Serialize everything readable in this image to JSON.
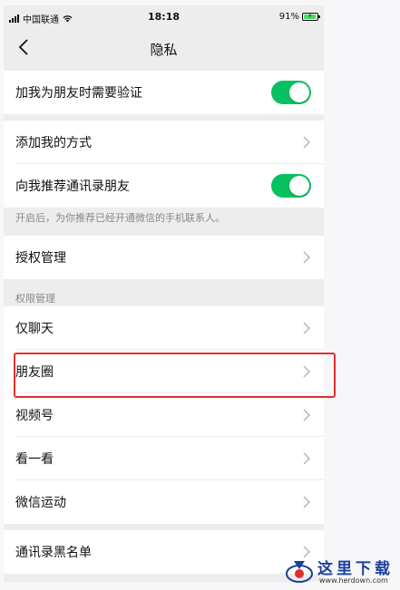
{
  "status_bar": {
    "carrier": "中国联通",
    "time": "18:18",
    "battery_percent": "91%",
    "battery_level": 0.91,
    "wifi_icon": "wifi-icon"
  },
  "nav": {
    "title": "隐私",
    "back_icon": "chevron-left-icon"
  },
  "items": {
    "verify_friend": {
      "label": "加我为朋友时需要验证",
      "toggle_on": true
    },
    "add_methods": {
      "label": "添加我的方式"
    },
    "recommend_contacts": {
      "label": "向我推荐通讯录朋友",
      "toggle_on": true
    },
    "recommend_note": "开启后，为你推荐已经开通微信的手机联系人。",
    "authorization": {
      "label": "授权管理"
    },
    "permissions_header": "权限管理",
    "chat_only": {
      "label": "仅聊天"
    },
    "moments": {
      "label": "朋友圈"
    },
    "channels": {
      "label": "视频号"
    },
    "top_stories": {
      "label": "看一看"
    },
    "werun": {
      "label": "微信运动"
    },
    "blacklist": {
      "label": "通讯录黑名单"
    }
  },
  "colors": {
    "toggle_on": "#07c160",
    "highlight": "#e0302a",
    "watermark": "#1c3f9c"
  },
  "watermark": {
    "text": "这里下载",
    "url": "www.herdown.com"
  }
}
